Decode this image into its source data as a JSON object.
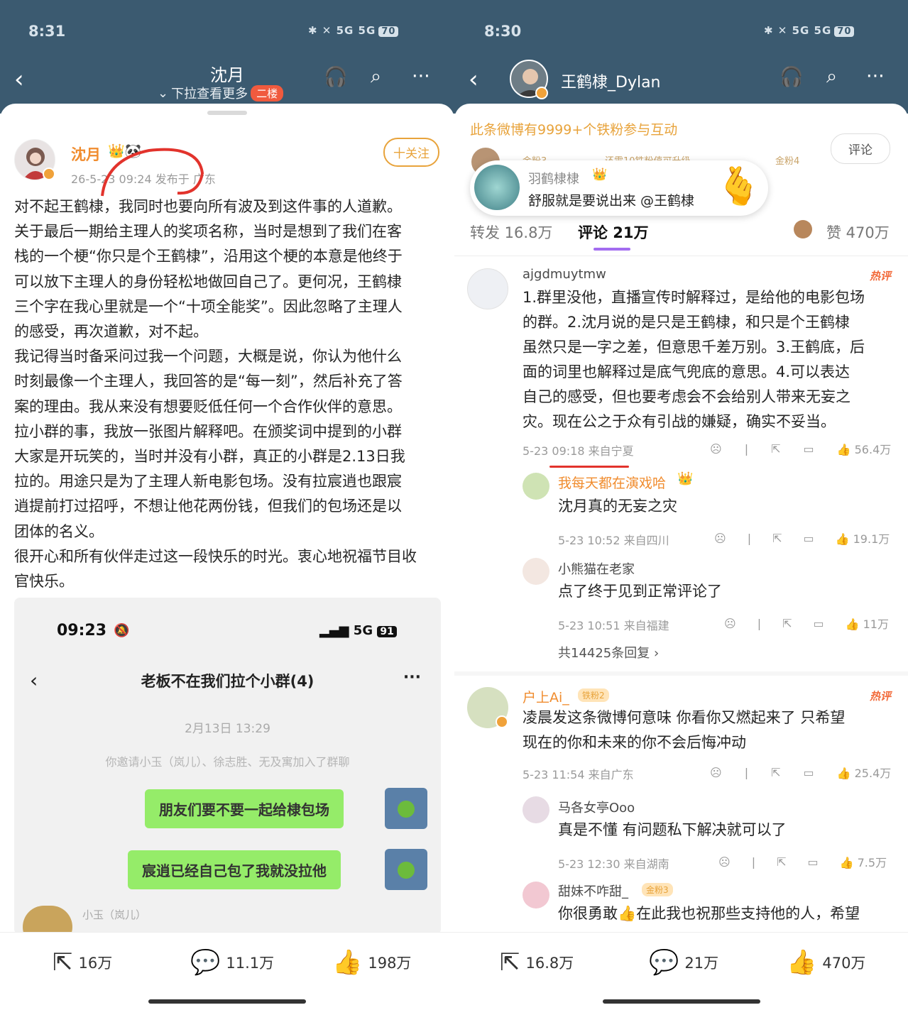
{
  "left": {
    "status": {
      "time": "8:31",
      "icons": "✱ ✕ 5G 5G",
      "battery": "70"
    },
    "nav": {
      "title": "沈月",
      "subtitle": "下拉查看更多",
      "badge": "二楼"
    },
    "post": {
      "author": "沈月",
      "meta": "26-5-23 09:24  发布于 广东",
      "follow": "十关注",
      "lines": [
        "对不起王鹤棣，我同时也要向所有波及到这件事的人道歉。",
        "关于最后一期给主理人的奖项名称，当时是想到了我们在客",
        "栈的一个梗“你只是个王鹤棣”，沿用这个梗的本意是他终于",
        "可以放下主理人的身份轻松地做回自己了。更何况，王鹤棣",
        "三个字在我心里就是一个“十项全能奖”。因此忽略了主理人",
        "的感受，再次道歉，对不起。",
        "我记得当时备采问过我一个问题，大概是说，你认为他什么",
        "时刻最像一个主理人，我回答的是“每一刻”，然后补充了答",
        "案的理由。我从来没有想要贬低任何一个合作伙伴的意思。",
        "拉小群的事，我放一张图片解释吧。在颁奖词中提到的小群",
        "大家是开玩笑的，当时并没有小群，真正的小群是2.13日我",
        "拉的。用途只是为了主理人新电影包场。没有拉宸逍也跟宸",
        "逍提前打过招呼，不想让他花两份钱，但我们的包场还是以",
        "团体的名义。",
        "很开心和所有伙伴走过这一段快乐的时光。衷心地祝福节目收",
        "官快乐。"
      ]
    },
    "chat": {
      "time": "09:23",
      "signal": "5G",
      "battery": "91",
      "title": "老板不在我们拉个小群(4)",
      "date": "2月13日 13:29",
      "system": "你邀请小玉（岚儿）、徐志胜、无及寓加入了群聊",
      "msg1": "朋友们要不要一起给棣包场",
      "msg2": "宸逍已经自己包了我就没拉他",
      "peer": "小玉（岚儿）"
    },
    "bottom": {
      "share": "16万",
      "comment": "11.1万",
      "like": "198万"
    }
  },
  "right": {
    "status": {
      "time": "8:30",
      "icons": "✱ ✕ 5G 5G",
      "battery": "70"
    },
    "nav": {
      "username": "王鹤棣_Dylan"
    },
    "fans_banner": "此条微博有9999+个铁粉参与互动",
    "fans_tags": [
      "金粉3",
      "还需10铁粉值可升级",
      "金粉4"
    ],
    "comment_btn": "评论",
    "popup": {
      "name": "羽鹤棣棣",
      "text": "舒服就是要说出来 @王鹤棣"
    },
    "tabs": {
      "repost": "转发 16.8万",
      "comments": "评论 21万",
      "likes": "赞 470万"
    },
    "hot_label": "热评",
    "comments": [
      {
        "user": "ajgdmuytmw",
        "lines": [
          "1.群里没他，直播宣传时解释过，是给他的电影包场",
          "的群。2.沈月说的是只是王鹤棣，和只是个王鹤棣",
          "虽然只是一字之差，但意思千差万别。3.王鹤底，后",
          "面的词里也解释过是底气兜底的意思。4.可以表达",
          "自己的感受，但也要考虑会不会给别人带来无妄之",
          "灾。现在公之于众有引战的嫌疑，确实不妥当。"
        ],
        "meta": "5-23 09:18  来自宁夏",
        "likes": "56.4万",
        "replies": [
          {
            "user": "我每天都在演戏哈",
            "text": "沈月真的无妄之灾",
            "meta": "5-23 10:52  来自四川",
            "likes": "19.1万"
          },
          {
            "user": "小熊猫在老家",
            "text": "点了终于见到正常评论了",
            "meta": "5-23 10:51  来自福建",
            "likes": "11万"
          }
        ],
        "more": "共14425条回复 ›"
      },
      {
        "user": "户上Ai_",
        "fan_badge": "铁粉2",
        "lines": [
          "凌晨发这条微博何意味 你看你又燃起来了 只希望",
          "现在的你和未来的你不会后悔冲动"
        ],
        "meta": "5-23 11:54  来自广东",
        "likes": "25.4万",
        "replies": [
          {
            "user": "马各女亭Ooo",
            "text": "真是不懂 有问题私下解决就可以了",
            "meta": "5-23 12:30  来自湖南",
            "likes": "7.5万"
          },
          {
            "user": "甜妹不咋甜_",
            "fan_badge": "金粉3",
            "text": "你很勇敢👍在此我也祝那些支持他的人，希望"
          }
        ]
      }
    ],
    "bottom": {
      "share": "16.8万",
      "comment": "21万",
      "like": "470万"
    }
  }
}
